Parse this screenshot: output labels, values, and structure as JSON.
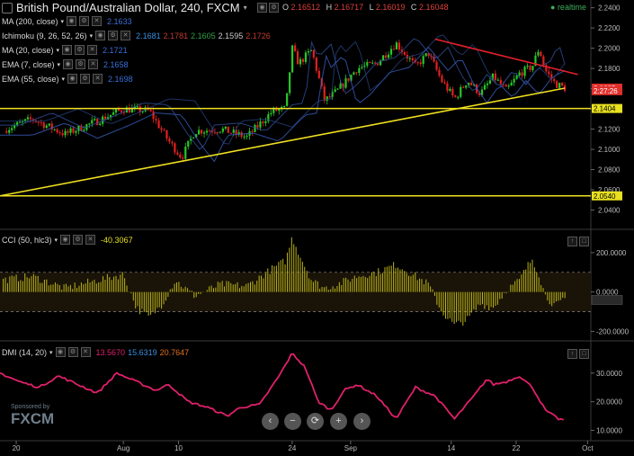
{
  "header": {
    "symbol": "British Pound/Australian Dollar",
    "interval": "240",
    "source": "FXCM",
    "title": "British Pound/Australian Dollar, 240, FXCM",
    "ohlc": {
      "o_label": "O",
      "o": "2.16512",
      "h_label": "H",
      "h": "2.16717",
      "l_label": "L",
      "l": "2.16019",
      "c_label": "C",
      "c": "2.16048"
    },
    "status": "realtime"
  },
  "overlays": [
    {
      "name": "MA (200, close)",
      "values": [
        {
          "v": "2.1633",
          "color": "#3a6fd8"
        }
      ]
    },
    {
      "name": "Ichimoku (9, 26, 52, 26)",
      "values": [
        {
          "v": "2.1681",
          "color": "#3a8fe0"
        },
        {
          "v": "2.1781",
          "color": "#c0392b"
        },
        {
          "v": "2.1605",
          "color": "#2ea043"
        },
        {
          "v": "2.1595",
          "color": "#c8c8c8"
        },
        {
          "v": "2.1726",
          "color": "#c0392b"
        }
      ]
    },
    {
      "name": "MA (20, close)",
      "values": [
        {
          "v": "2.1721",
          "color": "#3a6fd8"
        }
      ]
    },
    {
      "name": "EMA (7, close)",
      "values": [
        {
          "v": "2.1658",
          "color": "#3a6fd8"
        }
      ]
    },
    {
      "name": "EMA (55, close)",
      "values": [
        {
          "v": "2.1698",
          "color": "#3a6fd8"
        }
      ]
    }
  ],
  "price_axis": {
    "ticks": [
      "2.2400",
      "2.2200",
      "2.2000",
      "2.1800",
      "2.1600",
      "2.1400",
      "2.1200",
      "2.1000",
      "2.0800",
      "2.0600",
      "2.0400"
    ],
    "labels": [
      {
        "text": "2.1605",
        "bg": "#e0302c",
        "fg": "#ffffff",
        "value": 2.1605
      },
      {
        "text": "2:27:26",
        "bg": "#e0302c",
        "fg": "#ffffff",
        "value": 2.158
      },
      {
        "text": "2.1404",
        "bg": "#e8e020",
        "fg": "#000000",
        "value": 2.1404
      },
      {
        "text": "2.0540",
        "bg": "#e8e020",
        "fg": "#000000",
        "value": 2.054
      }
    ]
  },
  "cci": {
    "name": "CCI (50, hlc3)",
    "value": "-40.3067",
    "ticks": [
      "200.0000",
      "0.0000",
      "-200.0000"
    ],
    "bands": [
      100,
      -100
    ]
  },
  "dmi": {
    "name": "DMI (14, 20)",
    "values": [
      {
        "v": "13.5670",
        "color": "#e0206a"
      },
      {
        "v": "15.6319",
        "color": "#3a8fe0"
      },
      {
        "v": "20.7647",
        "color": "#e07020"
      }
    ],
    "ticks": [
      "30.0000",
      "20.0000",
      "10.0000"
    ]
  },
  "time_axis": [
    {
      "label": "20",
      "t": 5
    },
    {
      "label": "Aug",
      "t": 38
    },
    {
      "label": "10",
      "t": 55
    },
    {
      "label": "24",
      "t": 90
    },
    {
      "label": "Sep",
      "t": 108
    },
    {
      "label": "14",
      "t": 139
    },
    {
      "label": "22",
      "t": 159
    },
    {
      "label": "Oct",
      "t": 181
    }
  ],
  "watermark": {
    "sponsor": "Sponsored by",
    "brand": "FXCM"
  },
  "controls": [
    "zoom-out",
    "reset",
    "refresh",
    "zoom-in",
    "scroll-right"
  ],
  "colors": {
    "support": "#f0e020",
    "resistance": "#e0202a",
    "bull": "#28c828",
    "bear": "#e02020",
    "dmi_line": "#e0206a",
    "cci_bar": "#bcb419"
  },
  "chart_data": [
    {
      "type": "candlestick",
      "title": "British Pound/Australian Dollar, 240, FXCM",
      "ylim": [
        2.028,
        2.245
      ],
      "xlabel": "",
      "ylabel": "",
      "anchors_t": [
        0,
        10,
        20,
        30,
        38,
        46,
        52,
        56,
        60,
        68,
        76,
        84,
        88,
        90,
        92,
        96,
        100,
        104,
        110,
        116,
        122,
        128,
        132,
        136,
        140,
        144,
        148,
        152,
        156,
        160,
        164,
        166,
        168,
        171,
        174
      ],
      "anchors_close": [
        2.118,
        2.13,
        2.115,
        2.128,
        2.14,
        2.138,
        2.108,
        2.092,
        2.118,
        2.12,
        2.112,
        2.138,
        2.14,
        2.2,
        2.185,
        2.198,
        2.148,
        2.158,
        2.18,
        2.185,
        2.205,
        2.182,
        2.195,
        2.168,
        2.15,
        2.168,
        2.155,
        2.172,
        2.158,
        2.175,
        2.182,
        2.2,
        2.178,
        2.165,
        2.1605
      ],
      "trendlines": [
        {
          "name": "support-trend",
          "from": [
            0,
            2.054
          ],
          "to": [
            174,
            2.1605
          ]
        },
        {
          "name": "resistance-trend",
          "from": [
            134,
            2.209
          ],
          "to": [
            178,
            2.174
          ]
        }
      ],
      "horizontal_levels": [
        2.1404,
        2.054
      ]
    },
    {
      "type": "bar",
      "title": "CCI (50, hlc3)",
      "ylim": [
        -230,
        300
      ],
      "anchors_t": [
        0,
        10,
        20,
        30,
        38,
        42,
        46,
        50,
        54,
        60,
        68,
        76,
        84,
        88,
        90,
        92,
        96,
        100,
        104,
        110,
        116,
        122,
        128,
        132,
        136,
        140,
        144,
        148,
        152,
        156,
        160,
        162,
        164,
        166,
        168,
        171,
        174
      ],
      "anchors_v": [
        60,
        80,
        20,
        60,
        90,
        -80,
        -130,
        -60,
        60,
        -20,
        40,
        30,
        120,
        160,
        280,
        200,
        60,
        20,
        40,
        80,
        100,
        140,
        80,
        40,
        -100,
        -170,
        -140,
        -60,
        -80,
        10,
        60,
        120,
        170,
        90,
        -20,
        -70,
        -40.3067
      ]
    },
    {
      "type": "line",
      "title": "DMI (14, 20)",
      "ylim": [
        7,
        40
      ],
      "anchors_t": [
        0,
        6,
        12,
        18,
        24,
        30,
        36,
        42,
        48,
        52,
        58,
        64,
        70,
        74,
        80,
        86,
        90,
        94,
        98,
        102,
        106,
        110,
        116,
        122,
        128,
        134,
        140,
        146,
        150,
        152,
        156,
        160,
        164,
        168,
        172,
        174
      ],
      "anchors_v": [
        30,
        27,
        25,
        29,
        26,
        23,
        30,
        27,
        24,
        26,
        20,
        18,
        15,
        18,
        19,
        29,
        37,
        32,
        20,
        17,
        24,
        26,
        22,
        14,
        25,
        22,
        14,
        22,
        28,
        26,
        27,
        29,
        25,
        17,
        14,
        13.567
      ]
    }
  ]
}
